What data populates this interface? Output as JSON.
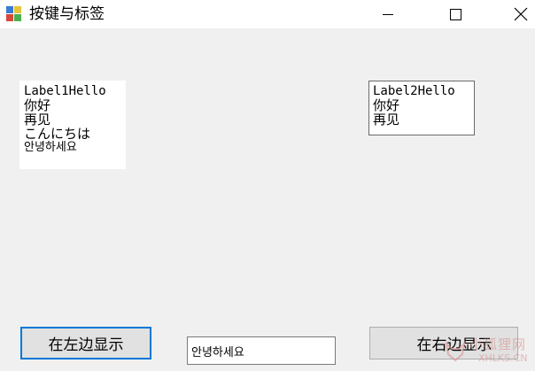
{
  "window": {
    "title": "按键与标签",
    "controls": {
      "minimize_icon": "minimize-icon",
      "maximize_icon": "maximize-icon",
      "close_icon": "close-icon"
    },
    "app_icon": "app-form-icon"
  },
  "label1": {
    "lines": [
      "Label1Hello",
      "你好",
      "再见",
      "こんにちは",
      "안녕하세요"
    ]
  },
  "label2": {
    "lines": [
      "Label2Hello",
      "你好",
      "再见"
    ]
  },
  "buttons": {
    "show_left": "在左边显示",
    "show_right": "在右边显示"
  },
  "textbox": {
    "value": "안녕하세요"
  },
  "watermark": {
    "cn": "小狐狸网",
    "en": "XHLKS.CN"
  },
  "colors": {
    "focus_border": "#0078d7",
    "button_face": "#e1e1e1",
    "form_bg": "#f0f0f0"
  }
}
